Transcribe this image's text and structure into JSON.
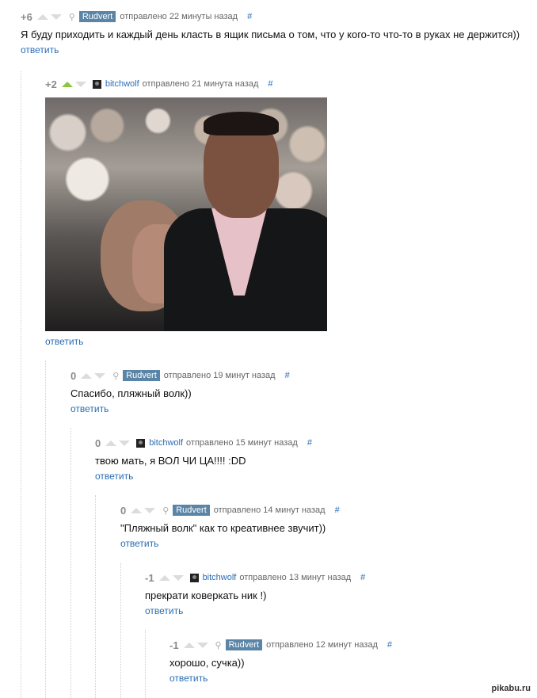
{
  "comments": [
    {
      "rating": "+6",
      "user": "Rudvert",
      "time": "отправлено 22 минуты назад",
      "hash": "#",
      "text": "Я буду приходить и каждый день класть в ящик письма о том, что у кого-то что-то в руках не держится))",
      "reply": "ответить"
    },
    {
      "rating": "+2",
      "user": "bitchwolf",
      "time": "отправлено 21 минута назад",
      "hash": "#",
      "reply": "ответить"
    },
    {
      "rating": "0",
      "user": "Rudvert",
      "time": "отправлено 19 минут назад",
      "hash": "#",
      "text": "Спасибо, пляжный волк))",
      "reply": "ответить"
    },
    {
      "rating": "0",
      "user": "bitchwolf",
      "time": "отправлено 15 минут назад",
      "hash": "#",
      "text": "твою мать, я ВОЛ ЧИ ЦА!!!! :DD",
      "reply": "ответить"
    },
    {
      "rating": "0",
      "user": "Rudvert",
      "time": "отправлено 14 минут назад",
      "hash": "#",
      "text": "\"Пляжный волк\" как то креативнее звучит))",
      "reply": "ответить"
    },
    {
      "rating": "-1",
      "user": "bitchwolf",
      "time": "отправлено 13 минут назад",
      "hash": "#",
      "text": "прекрати коверкать ник !)",
      "reply": "ответить"
    },
    {
      "rating": "-1",
      "user": "Rudvert",
      "time": "отправлено 12 минут назад",
      "hash": "#",
      "text": "хорошо, сучка))",
      "reply": "ответить"
    }
  ],
  "watermark": "pikabu.ru",
  "colors": {
    "user_badge": "#5b85a6",
    "link": "#2a6db4",
    "upvote_active": "#8cc63f"
  }
}
